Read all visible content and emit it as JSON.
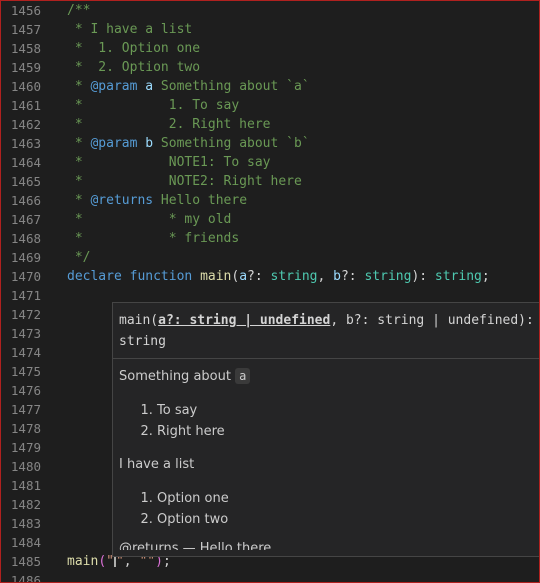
{
  "editor": {
    "lines": [
      {
        "n": "1456",
        "parts": [
          {
            "t": "/**",
            "c": "cm"
          }
        ]
      },
      {
        "n": "1457",
        "parts": [
          {
            "t": " * I have a list",
            "c": "cm"
          }
        ]
      },
      {
        "n": "1458",
        "parts": [
          {
            "t": " *  1. Option one",
            "c": "cm"
          }
        ]
      },
      {
        "n": "1459",
        "parts": [
          {
            "t": " *  2. Option two",
            "c": "cm"
          }
        ]
      },
      {
        "n": "1460",
        "parts": [
          {
            "t": " * ",
            "c": "cm"
          },
          {
            "t": "@param",
            "c": "doctag"
          },
          {
            "t": " ",
            "c": "cm"
          },
          {
            "t": "a",
            "c": "param"
          },
          {
            "t": " Something about `a`",
            "c": "cm"
          }
        ]
      },
      {
        "n": "1461",
        "parts": [
          {
            "t": " *           1. To say",
            "c": "cm"
          }
        ]
      },
      {
        "n": "1462",
        "parts": [
          {
            "t": " *           2. Right here",
            "c": "cm"
          }
        ]
      },
      {
        "n": "1463",
        "parts": [
          {
            "t": " * ",
            "c": "cm"
          },
          {
            "t": "@param",
            "c": "doctag"
          },
          {
            "t": " ",
            "c": "cm"
          },
          {
            "t": "b",
            "c": "param"
          },
          {
            "t": " Something about `b`",
            "c": "cm"
          }
        ]
      },
      {
        "n": "1464",
        "parts": [
          {
            "t": " *           NOTE1: To say",
            "c": "cm"
          }
        ]
      },
      {
        "n": "1465",
        "parts": [
          {
            "t": " *           NOTE2: Right here",
            "c": "cm"
          }
        ]
      },
      {
        "n": "1466",
        "parts": [
          {
            "t": " * ",
            "c": "cm"
          },
          {
            "t": "@returns",
            "c": "doctag"
          },
          {
            "t": " Hello there",
            "c": "cm"
          }
        ]
      },
      {
        "n": "1467",
        "parts": [
          {
            "t": " *           * my old",
            "c": "cm"
          }
        ]
      },
      {
        "n": "1468",
        "parts": [
          {
            "t": " *           * friends",
            "c": "cm"
          }
        ]
      },
      {
        "n": "1469",
        "parts": [
          {
            "t": " */",
            "c": "cm"
          }
        ]
      },
      {
        "n": "1470",
        "parts": [
          {
            "t": "declare",
            "c": "kw"
          },
          {
            "t": " ",
            "c": "punc"
          },
          {
            "t": "function",
            "c": "kw"
          },
          {
            "t": " ",
            "c": "punc"
          },
          {
            "t": "main",
            "c": "fn"
          },
          {
            "t": "(",
            "c": "punc"
          },
          {
            "t": "a",
            "c": "param"
          },
          {
            "t": "?: ",
            "c": "punc"
          },
          {
            "t": "string",
            "c": "ty"
          },
          {
            "t": ", ",
            "c": "punc"
          },
          {
            "t": "b",
            "c": "param"
          },
          {
            "t": "?: ",
            "c": "punc"
          },
          {
            "t": "string",
            "c": "ty"
          },
          {
            "t": "): ",
            "c": "punc"
          },
          {
            "t": "string",
            "c": "ty"
          },
          {
            "t": ";",
            "c": "punc"
          }
        ]
      },
      {
        "n": "1471",
        "parts": []
      },
      {
        "n": "1472",
        "parts": []
      },
      {
        "n": "1473",
        "parts": []
      },
      {
        "n": "1474",
        "parts": []
      },
      {
        "n": "1475",
        "parts": []
      },
      {
        "n": "1476",
        "parts": []
      },
      {
        "n": "1477",
        "parts": []
      },
      {
        "n": "1478",
        "parts": []
      },
      {
        "n": "1479",
        "parts": []
      },
      {
        "n": "1480",
        "parts": []
      },
      {
        "n": "1481",
        "parts": []
      },
      {
        "n": "1482",
        "parts": []
      },
      {
        "n": "1483",
        "parts": []
      },
      {
        "n": "1484",
        "parts": []
      },
      {
        "n": "1485",
        "parts": [
          {
            "t": "main",
            "c": "fn"
          },
          {
            "t": "(",
            "c": "bracket"
          },
          {
            "t": "\"",
            "c": "str"
          },
          {
            "t": "|",
            "c": "cursor"
          },
          {
            "t": "\"",
            "c": "str"
          },
          {
            "t": ", ",
            "c": "punc"
          },
          {
            "t": "\"\"",
            "c": "str"
          },
          {
            "t": ")",
            "c": "bracket"
          },
          {
            "t": ";",
            "c": "punc"
          }
        ]
      },
      {
        "n": "1486",
        "parts": []
      }
    ]
  },
  "hover": {
    "signature": {
      "fn_name": "main(",
      "active_param": "a?: string | undefined",
      "rest": ", b?: string | undefined):",
      "return_type": "string"
    },
    "param_doc_prefix": "Something about",
    "param_doc_code": "a",
    "param_list": [
      "To say",
      "Right here"
    ],
    "description": "I have a list",
    "description_list": [
      "Option one",
      "Option two"
    ],
    "clipped_text": "@returns — Hello there"
  }
}
